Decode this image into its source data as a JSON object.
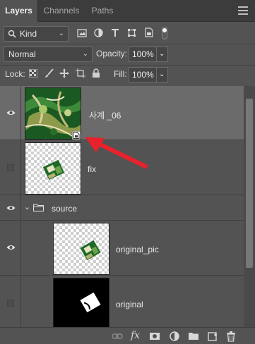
{
  "tabs": [
    {
      "label": "Layers"
    },
    {
      "label": "Channels"
    },
    {
      "label": "Paths"
    }
  ],
  "filter": {
    "kind_label": "Kind"
  },
  "blend": {
    "mode": "Normal",
    "opacity_label": "Opacity:",
    "opacity_value": "100%"
  },
  "lock": {
    "label": "Lock:",
    "fill_label": "Fill:",
    "fill_value": "100%"
  },
  "layers": [
    {
      "name": "사계 _06",
      "visible": true,
      "selected": true,
      "type": "smart-object"
    },
    {
      "name": "fix",
      "visible": false,
      "selected": false,
      "type": "layer"
    },
    {
      "name": "source",
      "visible": true,
      "selected": false,
      "type": "group"
    },
    {
      "name": "original_pic",
      "visible": true,
      "selected": false,
      "type": "layer"
    },
    {
      "name": "original",
      "visible": false,
      "selected": false,
      "type": "layer"
    }
  ],
  "colors": {
    "annotation_arrow": "#e8212a",
    "panel_bg": "#535353",
    "selected_row": "#6b6b6b"
  },
  "footer_icons": [
    "link-icon",
    "fx-icon",
    "mask-icon",
    "adjustment-icon",
    "folder-icon",
    "new-layer-icon",
    "trash-icon"
  ]
}
